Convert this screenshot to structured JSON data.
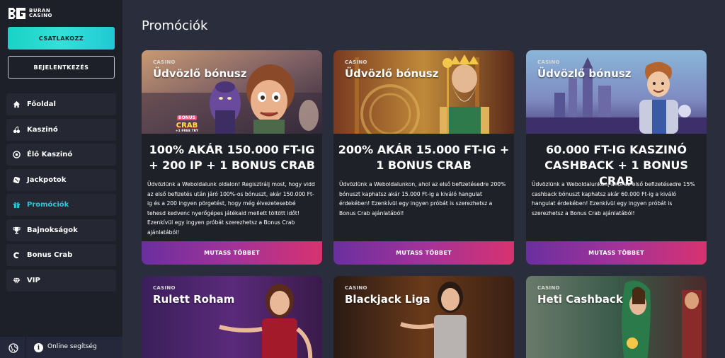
{
  "brand": {
    "line1": "BURAN",
    "line2": "CASINO"
  },
  "auth": {
    "join_label": "CSATLAKOZZ",
    "login_label": "BEJELENTKEZÉS"
  },
  "nav": [
    {
      "label": "Főoldal",
      "icon": "home-icon"
    },
    {
      "label": "Kaszinó",
      "icon": "cherries-icon"
    },
    {
      "label": "Élő Kaszinó",
      "icon": "chip-icon"
    },
    {
      "label": "Jackpotok",
      "icon": "dice-icon"
    },
    {
      "label": "Promóciók",
      "icon": "gift-icon"
    },
    {
      "label": "Bajnokságok",
      "icon": "trophy-icon"
    },
    {
      "label": "Bonus Crab",
      "icon": "crab-claw-icon"
    },
    {
      "label": "VIP",
      "icon": "diamond-icon"
    }
  ],
  "active_nav": "Promóciók",
  "footer": {
    "help_label": "Online segítség",
    "help_glyph": "i"
  },
  "page": {
    "title": "Promóciók"
  },
  "promos": [
    {
      "tag": "CASINO",
      "image_title": "Üdvözlő bónusz",
      "badge_line1": "BONUS",
      "badge_line2": "CRAB",
      "badge_line3": "+1 FREE TRY",
      "heading": "100% AKÁR 150.000 FT-IG + 200 IP + 1 BONUS CRAB",
      "body": "Üdvözlünk a Weboldalunk oldalon! Regisztrálj most, hogy vidd az első befizetés után járó 100%-os bónuszt, akár 150.000 Ft-ig és a 200 ingyen pörgetést, hogy még élvezetesebbé tehesd kedvenc nyerőgépes játékaid mellett töltött időt! Ezenkívül egy ingyen próbát szerezhetsz a Bonus Crab ajánlatából!",
      "button": "MUTASS TÖBBET"
    },
    {
      "tag": "CASINO",
      "image_title": "Üdvözlő bónusz",
      "heading": "200% AKÁR 15.000 FT-IG + 1 BONUS CRAB",
      "body": "Üdvözlünk a Weboldalunkon, ahol az első befizetésedre 200% bónuszt kaphatsz akár 15.000 Ft-ig a kiváló hangulat érdekében! Ezenkívül egy ingyen próbát is szerezhetsz a Bonus Crab ajánlatából!",
      "button": "MUTASS TÖBBET"
    },
    {
      "tag": "CASINO",
      "image_title": "Üdvözlő bónusz",
      "heading": "60.000 FT-IG KASZINÓ CASHBACK + 1 BONUS CRAB",
      "body": "Üdvözlünk a Weboldalunkon, ahol az első befizetésedre 15% cashback bónuszt kaphatsz akár 60.000 Ft-ig a kiváló hangulat érdekében! Ezenkívül egy ingyen próbát is szerezhetsz a Bonus Crab ajánlatából!",
      "button": "MUTASS TÖBBET"
    }
  ],
  "promos_row2": [
    {
      "tag": "CASINO",
      "image_title": "Rulett Roham"
    },
    {
      "tag": "CASINO",
      "image_title": "Blackjack Liga"
    },
    {
      "tag": "CASINO",
      "image_title": "Heti Cashback"
    }
  ],
  "colors": {
    "accent": "#25c8d8",
    "join_button": "#2ad9d0",
    "cta_gradient_start": "#6a2f9e",
    "cta_gradient_end": "#d8326f",
    "background": "#2a2e3c",
    "sidebar": "#1e2029"
  }
}
